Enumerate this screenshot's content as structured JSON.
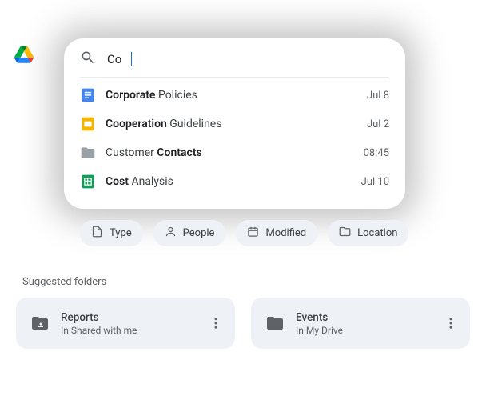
{
  "search": {
    "query": "Co"
  },
  "results": [
    {
      "icon": "docs",
      "title_prefix": "Co",
      "title_bold_rest": "rporate",
      "title_rest": " Policies",
      "date": "Jul 8"
    },
    {
      "icon": "slides",
      "title_prefix": "Co",
      "title_bold_rest": "operation",
      "title_rest": " Guidelines",
      "date": "Jul 2"
    },
    {
      "icon": "folder",
      "title_prefix": "",
      "title_bold_rest": "",
      "title_plain_pre": "Customer ",
      "title_bold_post": "Contacts",
      "date": "08:45"
    },
    {
      "icon": "sheets",
      "title_prefix": "Co",
      "title_bold_rest": "st",
      "title_rest": " Analysis",
      "date": "Jul 10"
    }
  ],
  "chips": [
    {
      "icon": "type",
      "label": "Type"
    },
    {
      "icon": "people",
      "label": "People"
    },
    {
      "icon": "modified",
      "label": "Modified"
    },
    {
      "icon": "location",
      "label": "Location"
    }
  ],
  "section_title": "Suggested folders",
  "folders": [
    {
      "icon": "shared-folder",
      "name": "Reports",
      "location": "In Shared with me"
    },
    {
      "icon": "folder",
      "name": "Events",
      "location": "In My Drive"
    }
  ]
}
